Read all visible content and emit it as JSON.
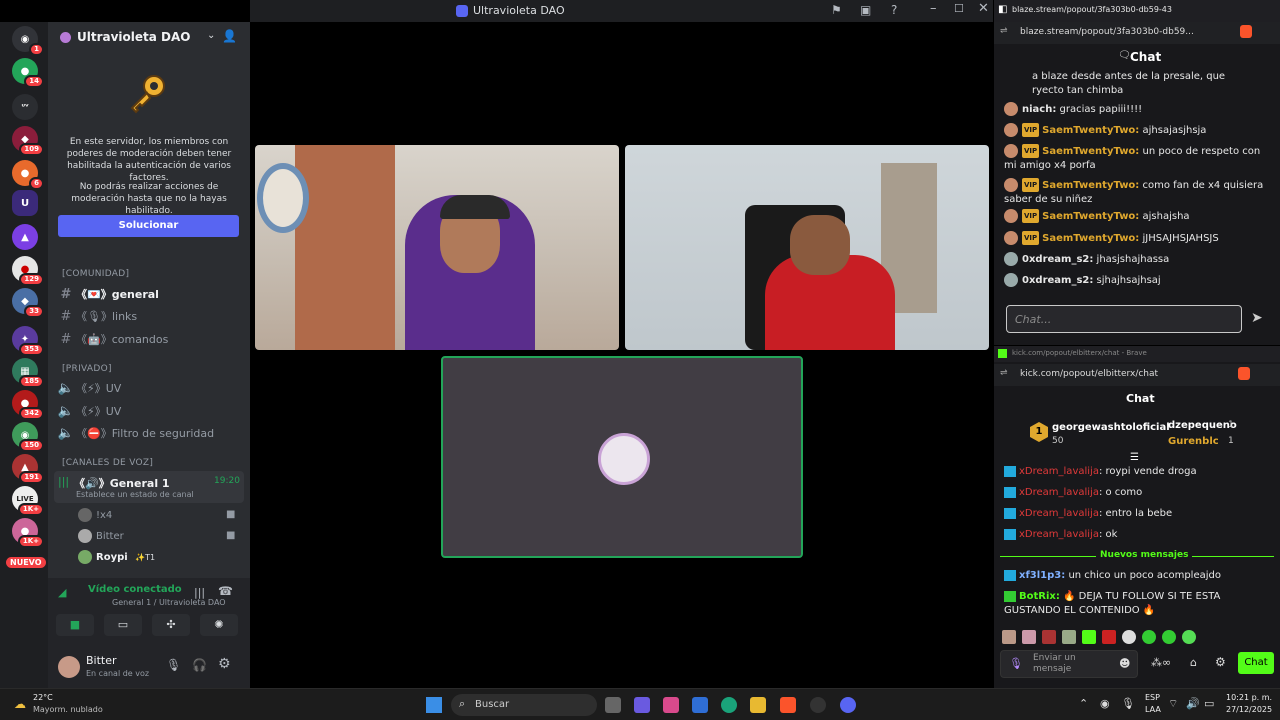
{
  "window": {
    "title": "Ultravioleta DAO"
  },
  "rail": {
    "badges": [
      "1",
      "14",
      "109",
      "6",
      "129",
      "33",
      "353",
      "185",
      "342",
      "150",
      "191",
      "1K+",
      "1K+"
    ],
    "new_label": "NUEVO"
  },
  "server": {
    "name": "Ultravioleta DAO",
    "notice_p1": "En este servidor, los miembros con poderes de moderación deben tener habilitada la autenticación de varios factores.",
    "notice_p2": "No podrás realizar acciones de moderación hasta que no la hayas habilitado.",
    "fix_button": "Solucionar"
  },
  "channels": {
    "cat_comunidad": "[COMUNIDAD]",
    "general": "《💌》general",
    "links": "《🎙》links",
    "comandos": "《🤖》comandos",
    "cat_privado": "[PRIVADO]",
    "uv1": "《⚡》UV",
    "uv2": "《⚡》UV",
    "filtro": "《⛔》Filtro de seguridad",
    "cat_voz": "[CANALES DE VOZ]",
    "general1": "《🔊》General 1",
    "general1_time": "19:20",
    "general1_status": "Establece un estado de canal",
    "users": [
      "!x4",
      "Bitter",
      "Roypi"
    ],
    "roypi_tag": "✨T1"
  },
  "voice": {
    "status": "Vídeo conectado",
    "path": "General 1 / Ultravioleta DAO"
  },
  "user": {
    "name": "Bitter",
    "status": "En canal de voz"
  },
  "browser1": {
    "tab": "blaze.stream/popout/3fa303b0-db59-43ba-89b...",
    "url": "blaze.stream/popout/3fa303b0-db59...",
    "chat_title": "Chat",
    "input_placeholder": "Chat...",
    "messages": [
      {
        "user": "",
        "text": "a blaze desde antes de la presale, que ryecto tan chimba"
      },
      {
        "user": "niach:",
        "text": "gracias papiii!!!!"
      },
      {
        "user": "SaemTwentyTwo:",
        "text": "ajhsajasjhsja",
        "vip": "VIP"
      },
      {
        "user": "SaemTwentyTwo:",
        "text": "un poco de respeto con mi amigo x4 porfa",
        "vip": "VIP"
      },
      {
        "user": "SaemTwentyTwo:",
        "text": "como fan de x4 quisiera saber de su niñez",
        "vip": "VIP"
      },
      {
        "user": "SaemTwentyTwo:",
        "text": "ajshajsha",
        "vip": "VIP"
      },
      {
        "user": "SaemTwentyTwo:",
        "text": "jJHSAJHSJAHSJS",
        "vip": "VIP"
      },
      {
        "user": "0xdream_s2:",
        "text": "jhasjshajhassa"
      },
      {
        "user": "0xdream_s2:",
        "text": "sjhajhsajhsaj"
      }
    ]
  },
  "browser2": {
    "tab": "kick.com/popout/elbitterx/chat - Brave",
    "url": "kick.com/popout/elbitterx/chat",
    "chat_title": "Chat",
    "top": [
      {
        "name": "georgewashtoloficial",
        "amount": "50",
        "rank": "1"
      },
      {
        "name": "dzepequeno",
        "amount": "1"
      },
      {
        "name": "Gurenblc",
        "amount": "1"
      }
    ],
    "messages": [
      {
        "user": "xDream_lavalija",
        "text": ": roypi vende droga"
      },
      {
        "user": "xDream_lavalija",
        "text": ": o como"
      },
      {
        "user": "xDream_lavalija",
        "text": ": entro la bebe"
      },
      {
        "user": "xDream_lavalija",
        "text": ": ok"
      }
    ],
    "new_messages": "Nuevos mensajes",
    "after": [
      {
        "user": "xf3l1p3:",
        "text": "un chico un poco acompleajdo"
      },
      {
        "user": "BotRix:",
        "text": "🔥 DEJA TU FOLLOW SI TE ESTA GUSTANDO EL CONTENIDO 🔥"
      }
    ],
    "input_placeholder": "Enviar un mensaje",
    "send": "Chat"
  },
  "taskbar": {
    "temp": "22°C",
    "weather": "Mayorm. nublado",
    "search": "Buscar",
    "lang1": "ESP",
    "lang2": "LAA",
    "time": "10:21 p. m.",
    "date": "27/12/2025"
  },
  "colors": {
    "accent": "#5865f2",
    "kick_green": "#53fc18",
    "vip": "#e0a82e",
    "name_orange": "#e0a82e"
  }
}
